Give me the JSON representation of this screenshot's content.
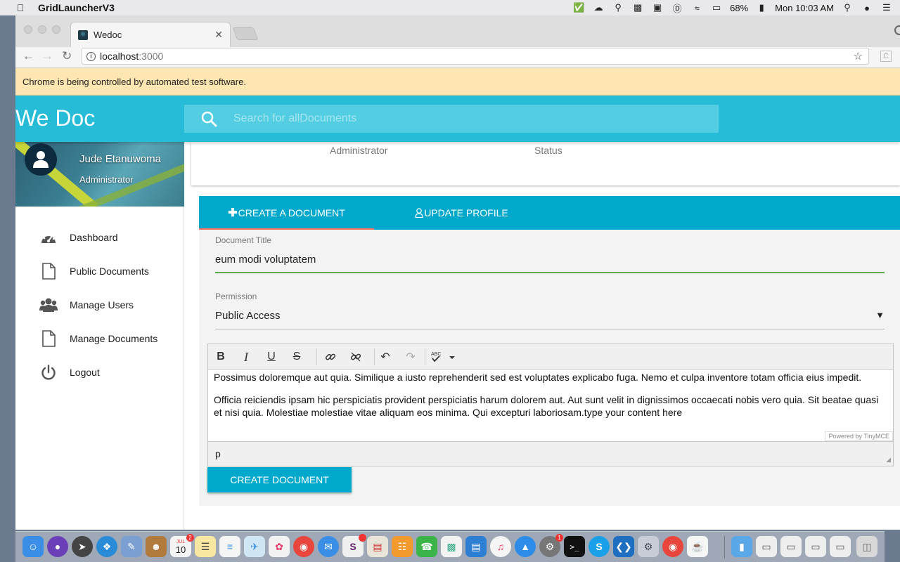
{
  "menubar": {
    "app_name": "GridLauncherV3",
    "battery": "68%",
    "clock": "Mon 10:03 AM"
  },
  "browser": {
    "tab_title": "Wedoc",
    "url_host": "localhost",
    "url_port": ":3000",
    "infobar_text": "Chrome is being controlled by automated test software."
  },
  "app": {
    "brand": "We Doc",
    "search_placeholder": "Search for allDocuments"
  },
  "profile": {
    "name": "Jude Etanuwoma",
    "role": "Administrator"
  },
  "sidebar": {
    "items": [
      {
        "label": "Dashboard",
        "icon": "dashboard-icon"
      },
      {
        "label": "Public Documents",
        "icon": "document-icon"
      },
      {
        "label": "Manage Users",
        "icon": "users-icon"
      },
      {
        "label": "Manage Documents",
        "icon": "document-icon"
      },
      {
        "label": "Logout",
        "icon": "power-icon"
      }
    ]
  },
  "card_top": {
    "col1": "Administrator",
    "col2": "Status"
  },
  "tabs": {
    "create": "CREATE A DOCUMENT",
    "update": "UPDATE PROFILE"
  },
  "form": {
    "title_label": "Document Title",
    "title_value": "eum modi voluptatem",
    "permission_label": "Permission",
    "permission_value": "Public Access"
  },
  "editor": {
    "paragraph1": "Possimus doloremque aut quia. Similique a iusto reprehenderit sed est voluptates explicabo fuga. Nemo et culpa inventore totam officia eius impedit.",
    "paragraph2": "Officia reiciendis ipsam hic perspiciatis provident perspiciatis harum dolorem aut. Aut sunt velit in dignissimos occaecati nobis vero quia. Sit beatae quasi et nisi quia. Molestiae molestiae vitae aliquam eos minima. Qui excepturi laboriosam.type your content here",
    "powered_by": "Powered by TinyMCE",
    "status_path": "p"
  },
  "submit_label": "CREATE DOCUMENT",
  "dock": {
    "calendar_month": "JUL",
    "calendar_day": "10",
    "calendar_badge": "2",
    "appstore_badge": "1"
  },
  "colors": {
    "appbar": "#26bcd7",
    "tabs": "#00a8cc",
    "tab_indicator": "#ff6f61",
    "title_underline": "#5cad4e"
  }
}
